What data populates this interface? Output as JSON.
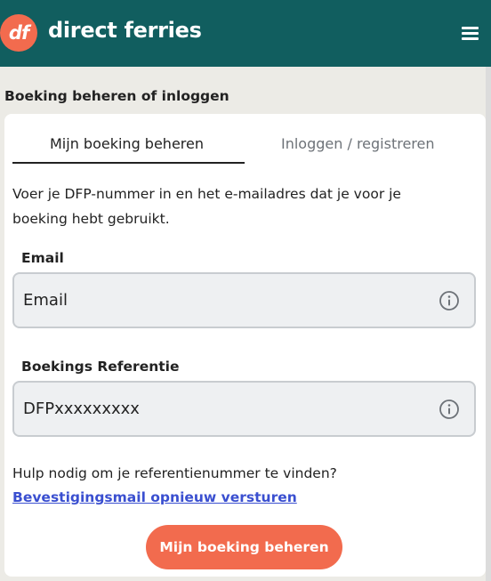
{
  "header": {
    "logo_text": "df",
    "brand": "direct ferries",
    "menu_icon": "hamburger-menu-icon",
    "color": "#115e5f",
    "accent": "#f26b4e"
  },
  "section_title": "Boeking beheren of inloggen",
  "tabs": [
    {
      "label": "Mijn boeking beheren",
      "active": true
    },
    {
      "label": "Inloggen / registreren",
      "active": false
    }
  ],
  "intro": "Voer je DFP-nummer in en het e-mailadres dat je voor je boeking hebt gebruikt.",
  "fields": {
    "email": {
      "label": "Email",
      "placeholder": "Email",
      "icon": "info-icon"
    },
    "reference": {
      "label": "Boekings Referentie",
      "placeholder": "DFPxxxxxxxxx",
      "icon": "info-icon"
    }
  },
  "help_text": "Hulp nodig om je referentienummer te vinden?",
  "resend_link": "Bevestigingsmail opnieuw versturen",
  "submit_label": "Mijn boeking beheren",
  "link_color": "#3a4fd0"
}
